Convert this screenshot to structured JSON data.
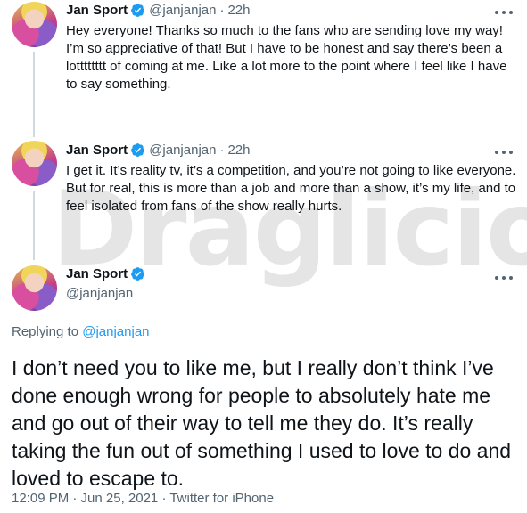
{
  "tweets": [
    {
      "author": "Jan Sport",
      "handle": "@janjanjan",
      "separator": "·",
      "time": "22h",
      "text": "Hey everyone! Thanks so much to the fans who are sending love my way! I’m so appreciative of that! But I have to be honest and say there’s been a lotttttttt of coming at me. Like a lot more to the point where I feel like I have to say something."
    },
    {
      "author": "Jan Sport",
      "handle": "@janjanjan",
      "separator": "·",
      "time": "22h",
      "text": "I get it. It’s reality tv, it’s a competition, and you’re not going to like everyone. But for real, this is more than a job and more than a show, it’s my life, and to feel isolated from fans of the show really hurts."
    }
  ],
  "main_tweet": {
    "author": "Jan Sport",
    "handle": "@janjanjan",
    "replying_prefix": "Replying to ",
    "replying_to": "@janjanjan",
    "text": "I don’t need you to like me, but I really don’t think I’ve done enough wrong for people to absolutely hate me and go out of their way to tell me they do. It’s really taking the fun out of something I used to love to do and loved to escape to.",
    "timestamp": "12:09 PM · Jun 25, 2021 · Twitter for iPhone"
  },
  "watermark": "Draglicious",
  "colors": {
    "verified": "#1d9bf0",
    "mention": "#1d9bf0",
    "muted": "#536471",
    "thread_line": "#cfd9de"
  }
}
